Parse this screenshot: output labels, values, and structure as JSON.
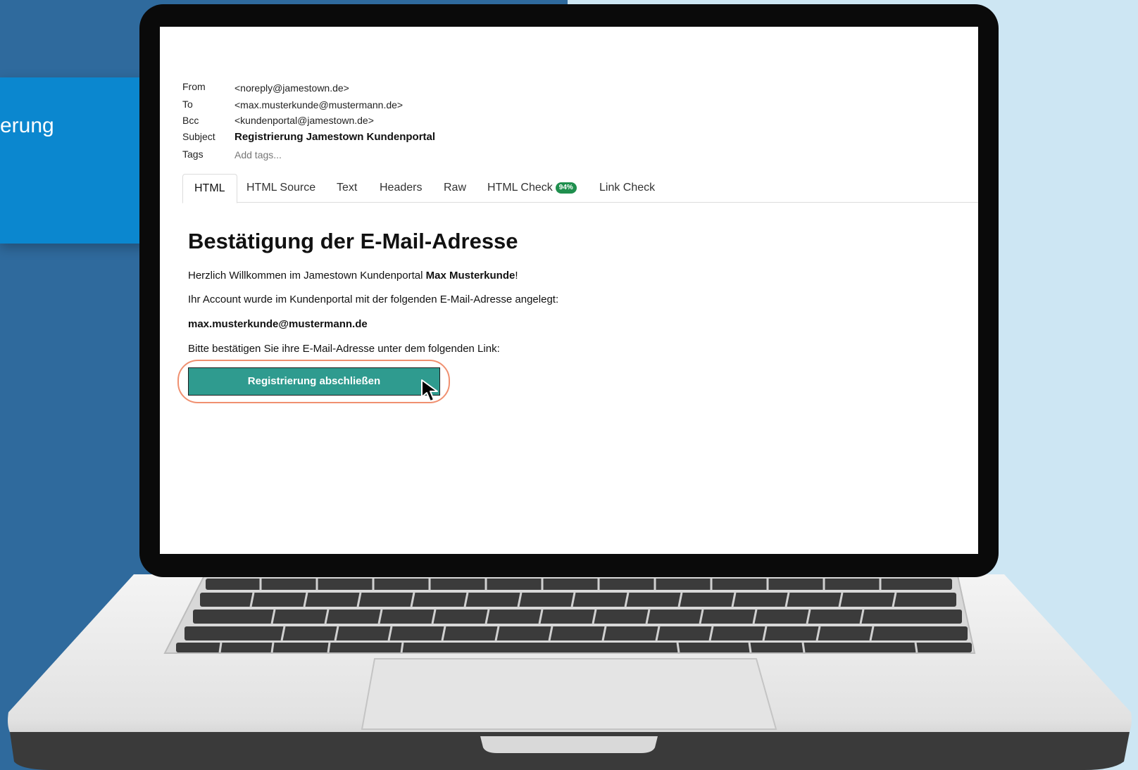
{
  "side_panel": {
    "text": "erung"
  },
  "email": {
    "header": {
      "from_label": "From",
      "from_value": "<noreply@jamestown.de>",
      "to_label": "To",
      "to_value": "<max.musterkunde@mustermann.de>",
      "bcc_label": "Bcc",
      "bcc_value": "<kundenportal@jamestown.de>",
      "subject_label": "Subject",
      "subject_value": "Registrierung Jamestown Kundenportal",
      "tags_label": "Tags",
      "tags_placeholder": "Add tags..."
    },
    "tabs": [
      {
        "label": "HTML",
        "active": true
      },
      {
        "label": "HTML Source"
      },
      {
        "label": "Text"
      },
      {
        "label": "Headers"
      },
      {
        "label": "Raw"
      },
      {
        "label": "HTML Check",
        "badge": "94%"
      },
      {
        "label": "Link Check"
      }
    ],
    "body": {
      "title": "Bestätigung der E-Mail-Adresse",
      "welcome_prefix": "Herzlich Willkommen im Jamestown Kundenportal ",
      "welcome_name": "Max Musterkunde",
      "welcome_suffix": "!",
      "account_text": "Ihr Account wurde im Kundenportal mit der folgenden E-Mail-Adresse angelegt:",
      "email_address": "max.musterkunde@mustermann.de",
      "confirm_text": "Bitte bestätigen Sie ihre E-Mail-Adresse unter dem folgenden Link:",
      "cta_label": "Registrierung abschließen"
    }
  },
  "colors": {
    "background_left": "#2f6a9d",
    "background_right": "#cde6f3",
    "side_panel": "#0b87cf",
    "cta": "#2f9b8f",
    "cta_ring": "#f09070",
    "badge": "#1f8f4e"
  },
  "icons": [
    "mouse-cursor-icon"
  ]
}
